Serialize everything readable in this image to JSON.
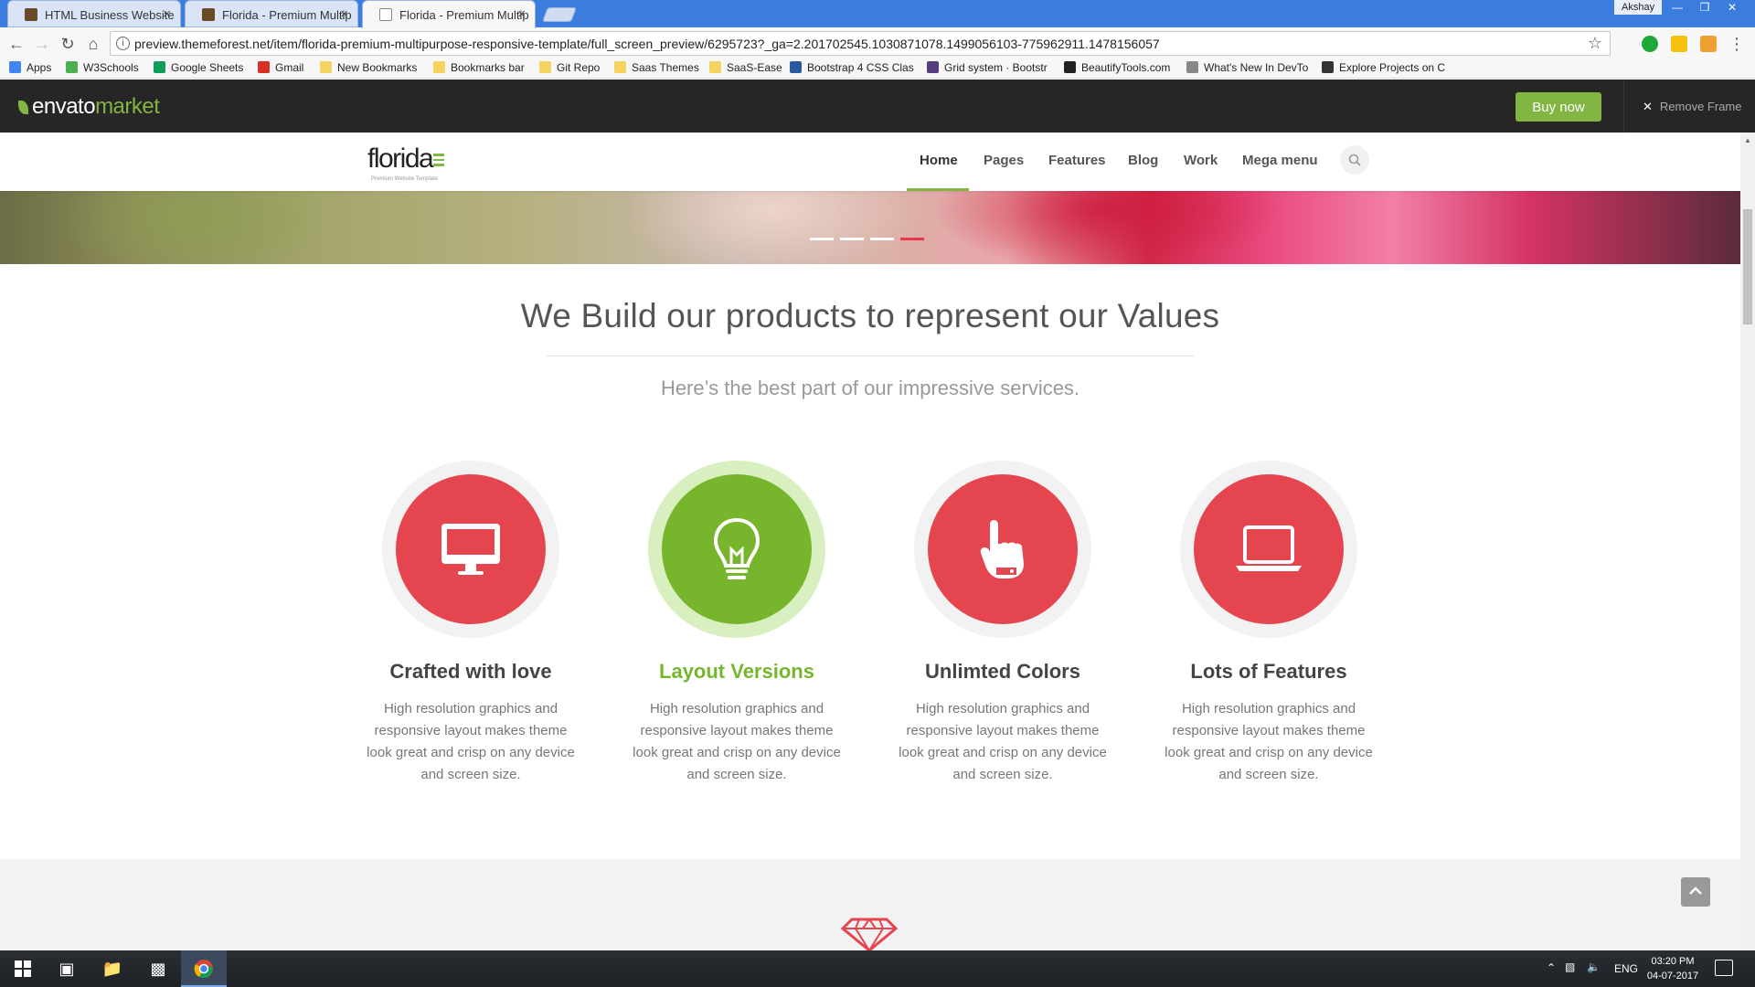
{
  "browser": {
    "tabs": [
      {
        "label": "HTML Business Website"
      },
      {
        "label": "Florida - Premium Multip"
      },
      {
        "label": "Florida - Premium Multip"
      }
    ],
    "tab_close_glyph": "×",
    "profile_name": "Akshay",
    "url": "preview.themeforest.net/item/florida-premium-multipurpose-responsive-template/full_screen_preview/6295723?_ga=2.201702545.1030871078.1499056103-775962911.1478156057",
    "bookmarks": [
      {
        "label": "Apps",
        "icon": "apps-grid-icon",
        "color": "#4285f4"
      },
      {
        "label": "W3Schools",
        "icon": "w3schools-icon",
        "color": "#4caf50"
      },
      {
        "label": "Google Sheets",
        "icon": "sheets-icon",
        "color": "#0f9d58"
      },
      {
        "label": "Gmail",
        "icon": "gmail-icon",
        "color": "#d93025"
      },
      {
        "label": "New Bookmarks",
        "icon": "folder-icon",
        "color": "#f4d35e"
      },
      {
        "label": "Bookmarks bar",
        "icon": "folder-icon",
        "color": "#f4d35e"
      },
      {
        "label": "Git Repo",
        "icon": "folder-icon",
        "color": "#f4d35e"
      },
      {
        "label": "Saas Themes",
        "icon": "folder-icon",
        "color": "#f4d35e"
      },
      {
        "label": "SaaS-Ease",
        "icon": "folder-icon",
        "color": "#f4d35e"
      },
      {
        "label": "Bootstrap 4 CSS Clas",
        "icon": "bootstrap-icon",
        "color": "#2c5aa0"
      },
      {
        "label": "Grid system · Bootstr",
        "icon": "bootstrap-b-icon",
        "color": "#563d7c"
      },
      {
        "label": "BeautifyTools.com",
        "icon": "beautify-icon",
        "color": "#222222"
      },
      {
        "label": "What's New In DevTo",
        "icon": "devtools-icon",
        "color": "#888888"
      },
      {
        "label": "Explore Projects on C",
        "icon": "codepen-icon",
        "color": "#333333"
      }
    ]
  },
  "envato": {
    "logo_text": "envato",
    "logo_suffix": "market",
    "buy_now_label": "Buy now",
    "remove_frame_label": "Remove Frame",
    "close_glyph": "✕"
  },
  "site": {
    "logo": "florida",
    "logo_tagline": "Premium Website Template",
    "nav": [
      {
        "label": "Home",
        "active": true
      },
      {
        "label": "Pages"
      },
      {
        "label": "Features"
      },
      {
        "label": "Blog"
      },
      {
        "label": "Work"
      },
      {
        "label": "Mega menu"
      }
    ],
    "slider_active_index": 3,
    "section_title": "We Build our products to represent our Values",
    "section_subtitle": "Here’s the best part of our impressive services.",
    "features": [
      {
        "title": "Crafted with love",
        "text": "High resolution graphics and responsive layout makes theme look great and crisp on any device and screen size.",
        "icon": "desktop-monitor-icon",
        "color": "#e5454f"
      },
      {
        "title": "Layout Versions",
        "text": "High resolution graphics and responsive layout makes theme look great and crisp on any device and screen size.",
        "icon": "lightbulb-icon",
        "color": "#76b52c"
      },
      {
        "title": "Unlimted Colors",
        "text": "High resolution graphics and responsive layout makes theme look great and crisp on any device and screen size.",
        "icon": "pointing-hand-icon",
        "color": "#e5454f"
      },
      {
        "title": "Lots of Features",
        "text": "High resolution graphics and responsive layout makes theme look great and crisp on any device and screen size.",
        "icon": "laptop-icon",
        "color": "#e5454f"
      }
    ],
    "accent_green": "#82b541",
    "accent_red": "#e5454f"
  },
  "taskbar": {
    "language": "ENG",
    "time": "03:20 PM",
    "date": "04-07-2017"
  }
}
